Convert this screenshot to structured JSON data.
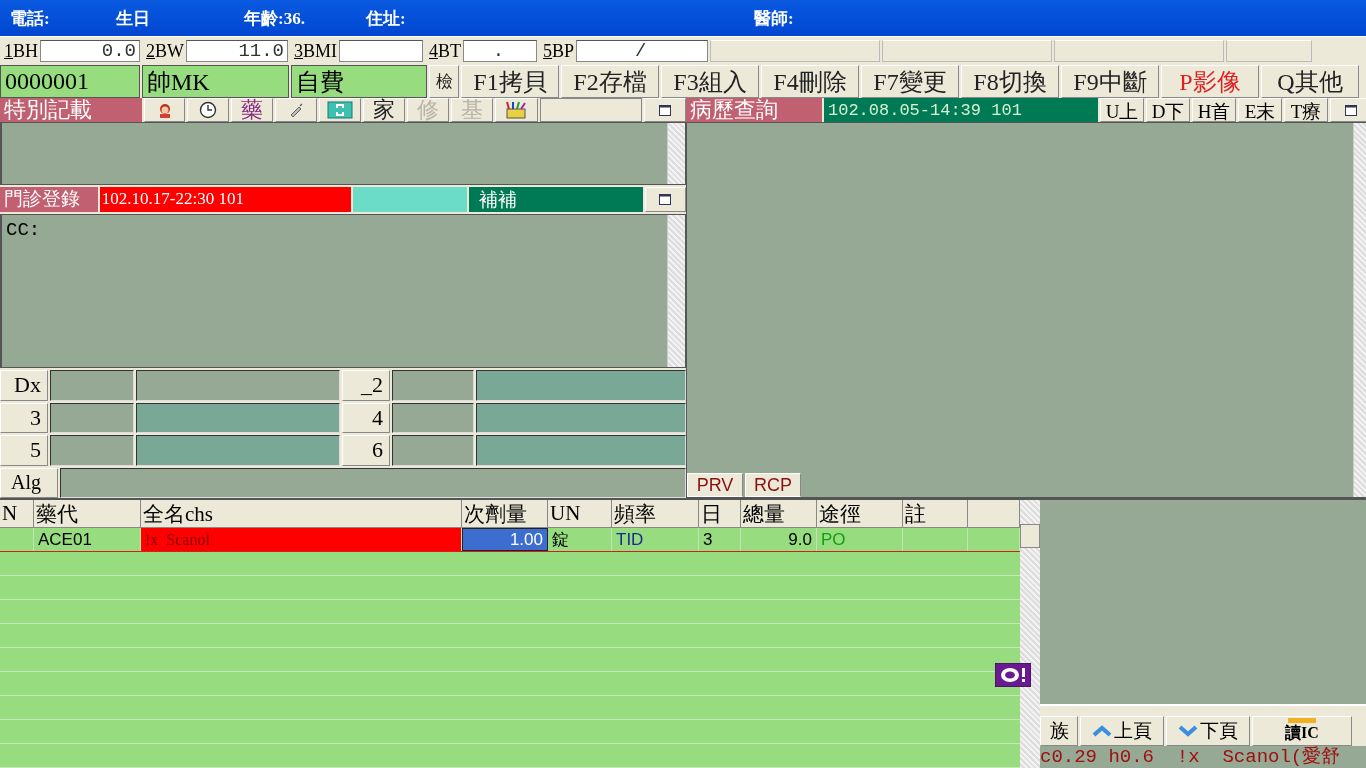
{
  "header": {
    "fields": [
      "電話:",
      "生日",
      "年齡:36.",
      "住址:",
      "醫師:"
    ]
  },
  "vitals": [
    {
      "label": "1BH",
      "value": "0.0"
    },
    {
      "label": "2BW",
      "value": "11.0"
    },
    {
      "label": "3BMI"
    },
    {
      "label": "4BT",
      "value": "."
    },
    {
      "label": "5BP",
      "value": "/"
    }
  ],
  "patient": {
    "id": "0000001",
    "name": "帥MK",
    "payment": "自費"
  },
  "function_buttons": [
    {
      "label": "檢"
    },
    {
      "label": "F1拷貝"
    },
    {
      "label": "F2存檔"
    },
    {
      "label": "F3組入"
    },
    {
      "label": "F4刪除"
    },
    {
      "label": "F7變更"
    },
    {
      "label": "F8切換"
    },
    {
      "label": "F9中斷"
    },
    {
      "label": "P影像",
      "color": "#e02020"
    },
    {
      "label": "Q其他"
    }
  ],
  "special_notes": {
    "title": "特別記載",
    "buttons": [
      {
        "label": "藥",
        "disabled": false
      },
      {
        "label": "家",
        "disabled": false
      },
      {
        "label": "修",
        "disabled": true
      },
      {
        "label": "基",
        "disabled": true
      }
    ]
  },
  "history": {
    "title": "病歷查詢",
    "record": "102.08.05-14:39  101",
    "nav": [
      "U上",
      "D下",
      "H首",
      "E末",
      "T療"
    ],
    "tabs": [
      "PRV",
      "RCP"
    ]
  },
  "registration": {
    "title": "門診登錄",
    "visit": "102.10.17-22:30 101",
    "note": "補補",
    "cc": "CC:"
  },
  "diagnosis": {
    "buttons": [
      "Dx",
      "_2",
      "3",
      "4",
      "5",
      "6"
    ],
    "allergy": "Alg"
  },
  "orders": {
    "columns": [
      "N",
      "藥代",
      "全名chs",
      "次劑量",
      "UN",
      "頻率",
      "日",
      "總量",
      "途徑",
      "註"
    ],
    "rows": [
      [
        "",
        "ACE01",
        "!x  Scanol",
        "1.00",
        "錠",
        "TID",
        "3",
        "9.0",
        "PO",
        ""
      ]
    ]
  },
  "side": {
    "buttons": [
      "族",
      "上頁",
      "下頁",
      "讀IC"
    ],
    "status": "c0.29 h0.6  !x  Scanol(愛舒"
  }
}
